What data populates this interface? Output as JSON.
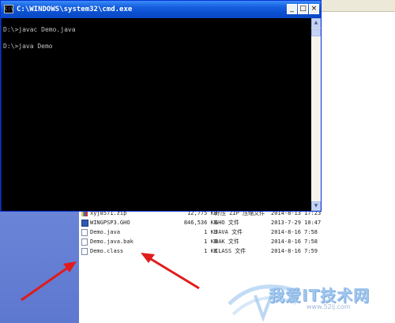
{
  "cmd_window": {
    "title": "C:\\WINDOWS\\system32\\cmd.exe",
    "icon_glyph": "C:\\",
    "controls": {
      "minimize": "_",
      "maximize": "□",
      "close": "×"
    },
    "lines": [
      "D:\\>javac Demo.java",
      "D:\\>java Demo"
    ]
  },
  "file_list": {
    "rows": [
      {
        "icon": "zip-icon",
        "name": "xyj8571.zip",
        "size": "12,775 KB",
        "type": "好压 ZIP 压缩文件",
        "date": "2014-8-13 17:23"
      },
      {
        "icon": "ghost-image-icon",
        "name": "WINGPSP3.GHO",
        "size": "846,536 KB",
        "type": "GHO 文件",
        "date": "2013-7-29 10:47"
      },
      {
        "icon": "file-icon",
        "name": "Demo.java",
        "size": "1 KB",
        "type": "JAVA 文件",
        "date": "2014-8-16 7:58"
      },
      {
        "icon": "file-icon",
        "name": "Demo.java.bak",
        "size": "1 KB",
        "type": "BAK 文件",
        "date": "2014-8-16 7:58"
      },
      {
        "icon": "file-icon",
        "name": "Demo.class",
        "size": "1 KB",
        "type": "CLASS 文件",
        "date": "2014-8-16 7:59"
      }
    ]
  },
  "watermark": {
    "text": "我爱IT技术网",
    "url": "www.52ij.com"
  },
  "colors": {
    "titlebar": "#0a4fcf",
    "console_bg": "#000000",
    "console_text": "#c0c0c0",
    "arrow": "#e11b1b",
    "taskpane": "#6c86d8"
  }
}
